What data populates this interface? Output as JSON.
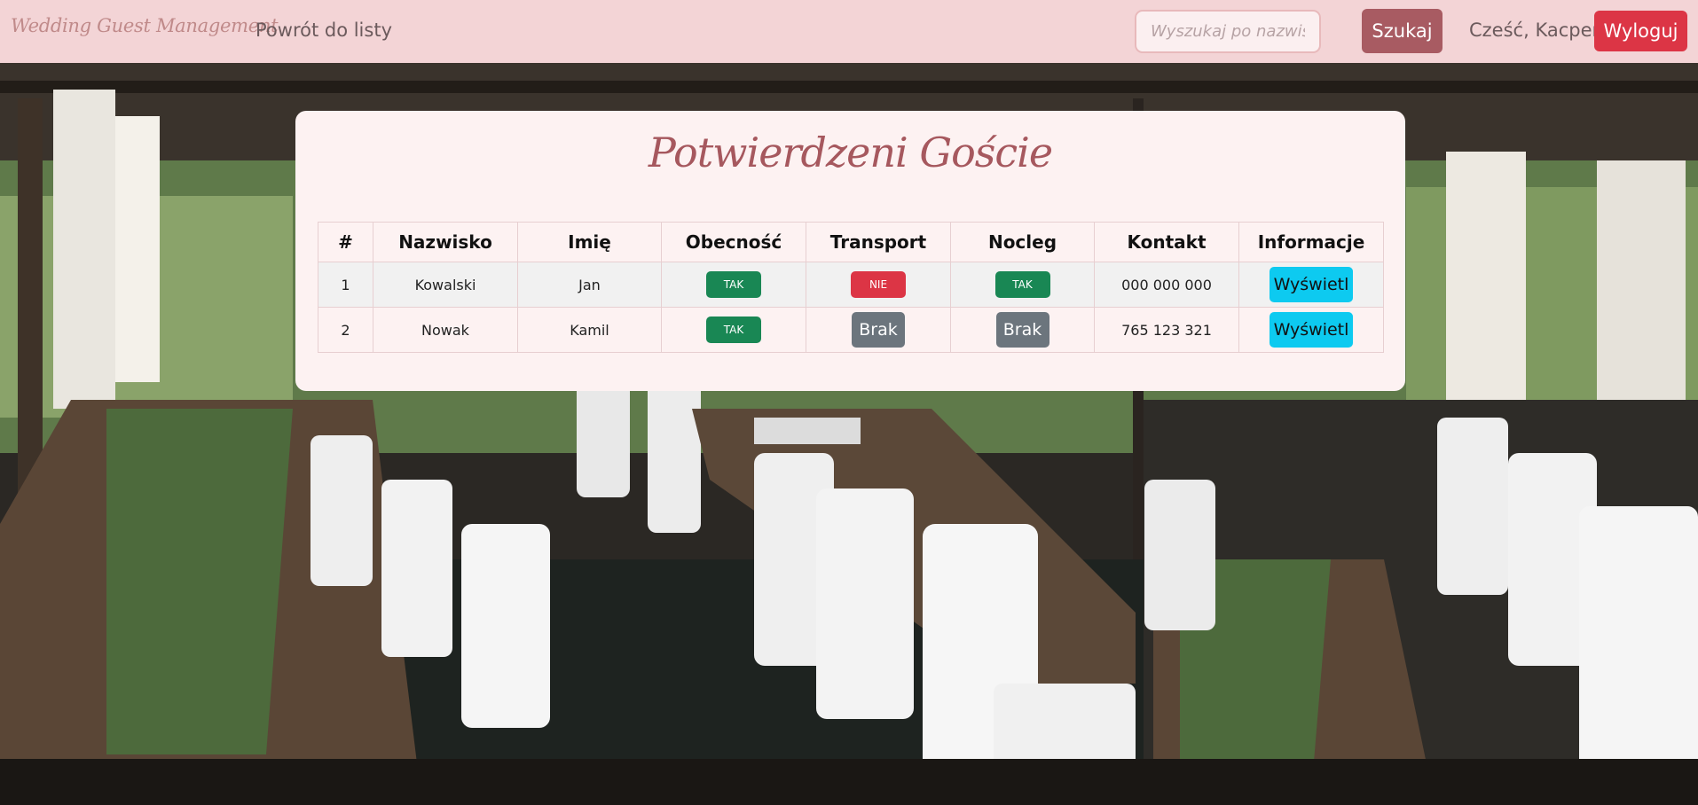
{
  "navbar": {
    "brand": "Wedding Guest Management",
    "back_link": "Powrót do listy",
    "search_placeholder": "Wyszukaj po nazwisku",
    "search_button": "Szukaj",
    "greeting": "Cześć, Kacper",
    "logout_button": "Wyloguj"
  },
  "main": {
    "title": "Potwierdzeni Goście",
    "table": {
      "headers": [
        "#",
        "Nazwisko",
        "Imię",
        "Obecność",
        "Transport",
        "Nocleg",
        "Kontakt",
        "Informacje"
      ],
      "rows": [
        {
          "num": "1",
          "surname": "Kowalski",
          "name": "Jan",
          "presence": "TAK",
          "transport": "NIE",
          "lodging": "TAK",
          "contact": "000 000 000",
          "info": "Wyświetl"
        },
        {
          "num": "2",
          "surname": "Nowak",
          "name": "Kamil",
          "presence": "TAK",
          "transport": "Brak",
          "lodging": "Brak",
          "contact": "765 123 321",
          "info": "Wyświetl"
        }
      ]
    }
  },
  "colors": {
    "navbar_bg": "#f3d4d6",
    "search_button": "#a85b62",
    "logout_button": "#dc3545",
    "badge_yes": "#198754",
    "badge_no": "#dc3545",
    "badge_none": "#6c757d",
    "info_button": "#0dcaf0",
    "title": "#a6585e"
  }
}
